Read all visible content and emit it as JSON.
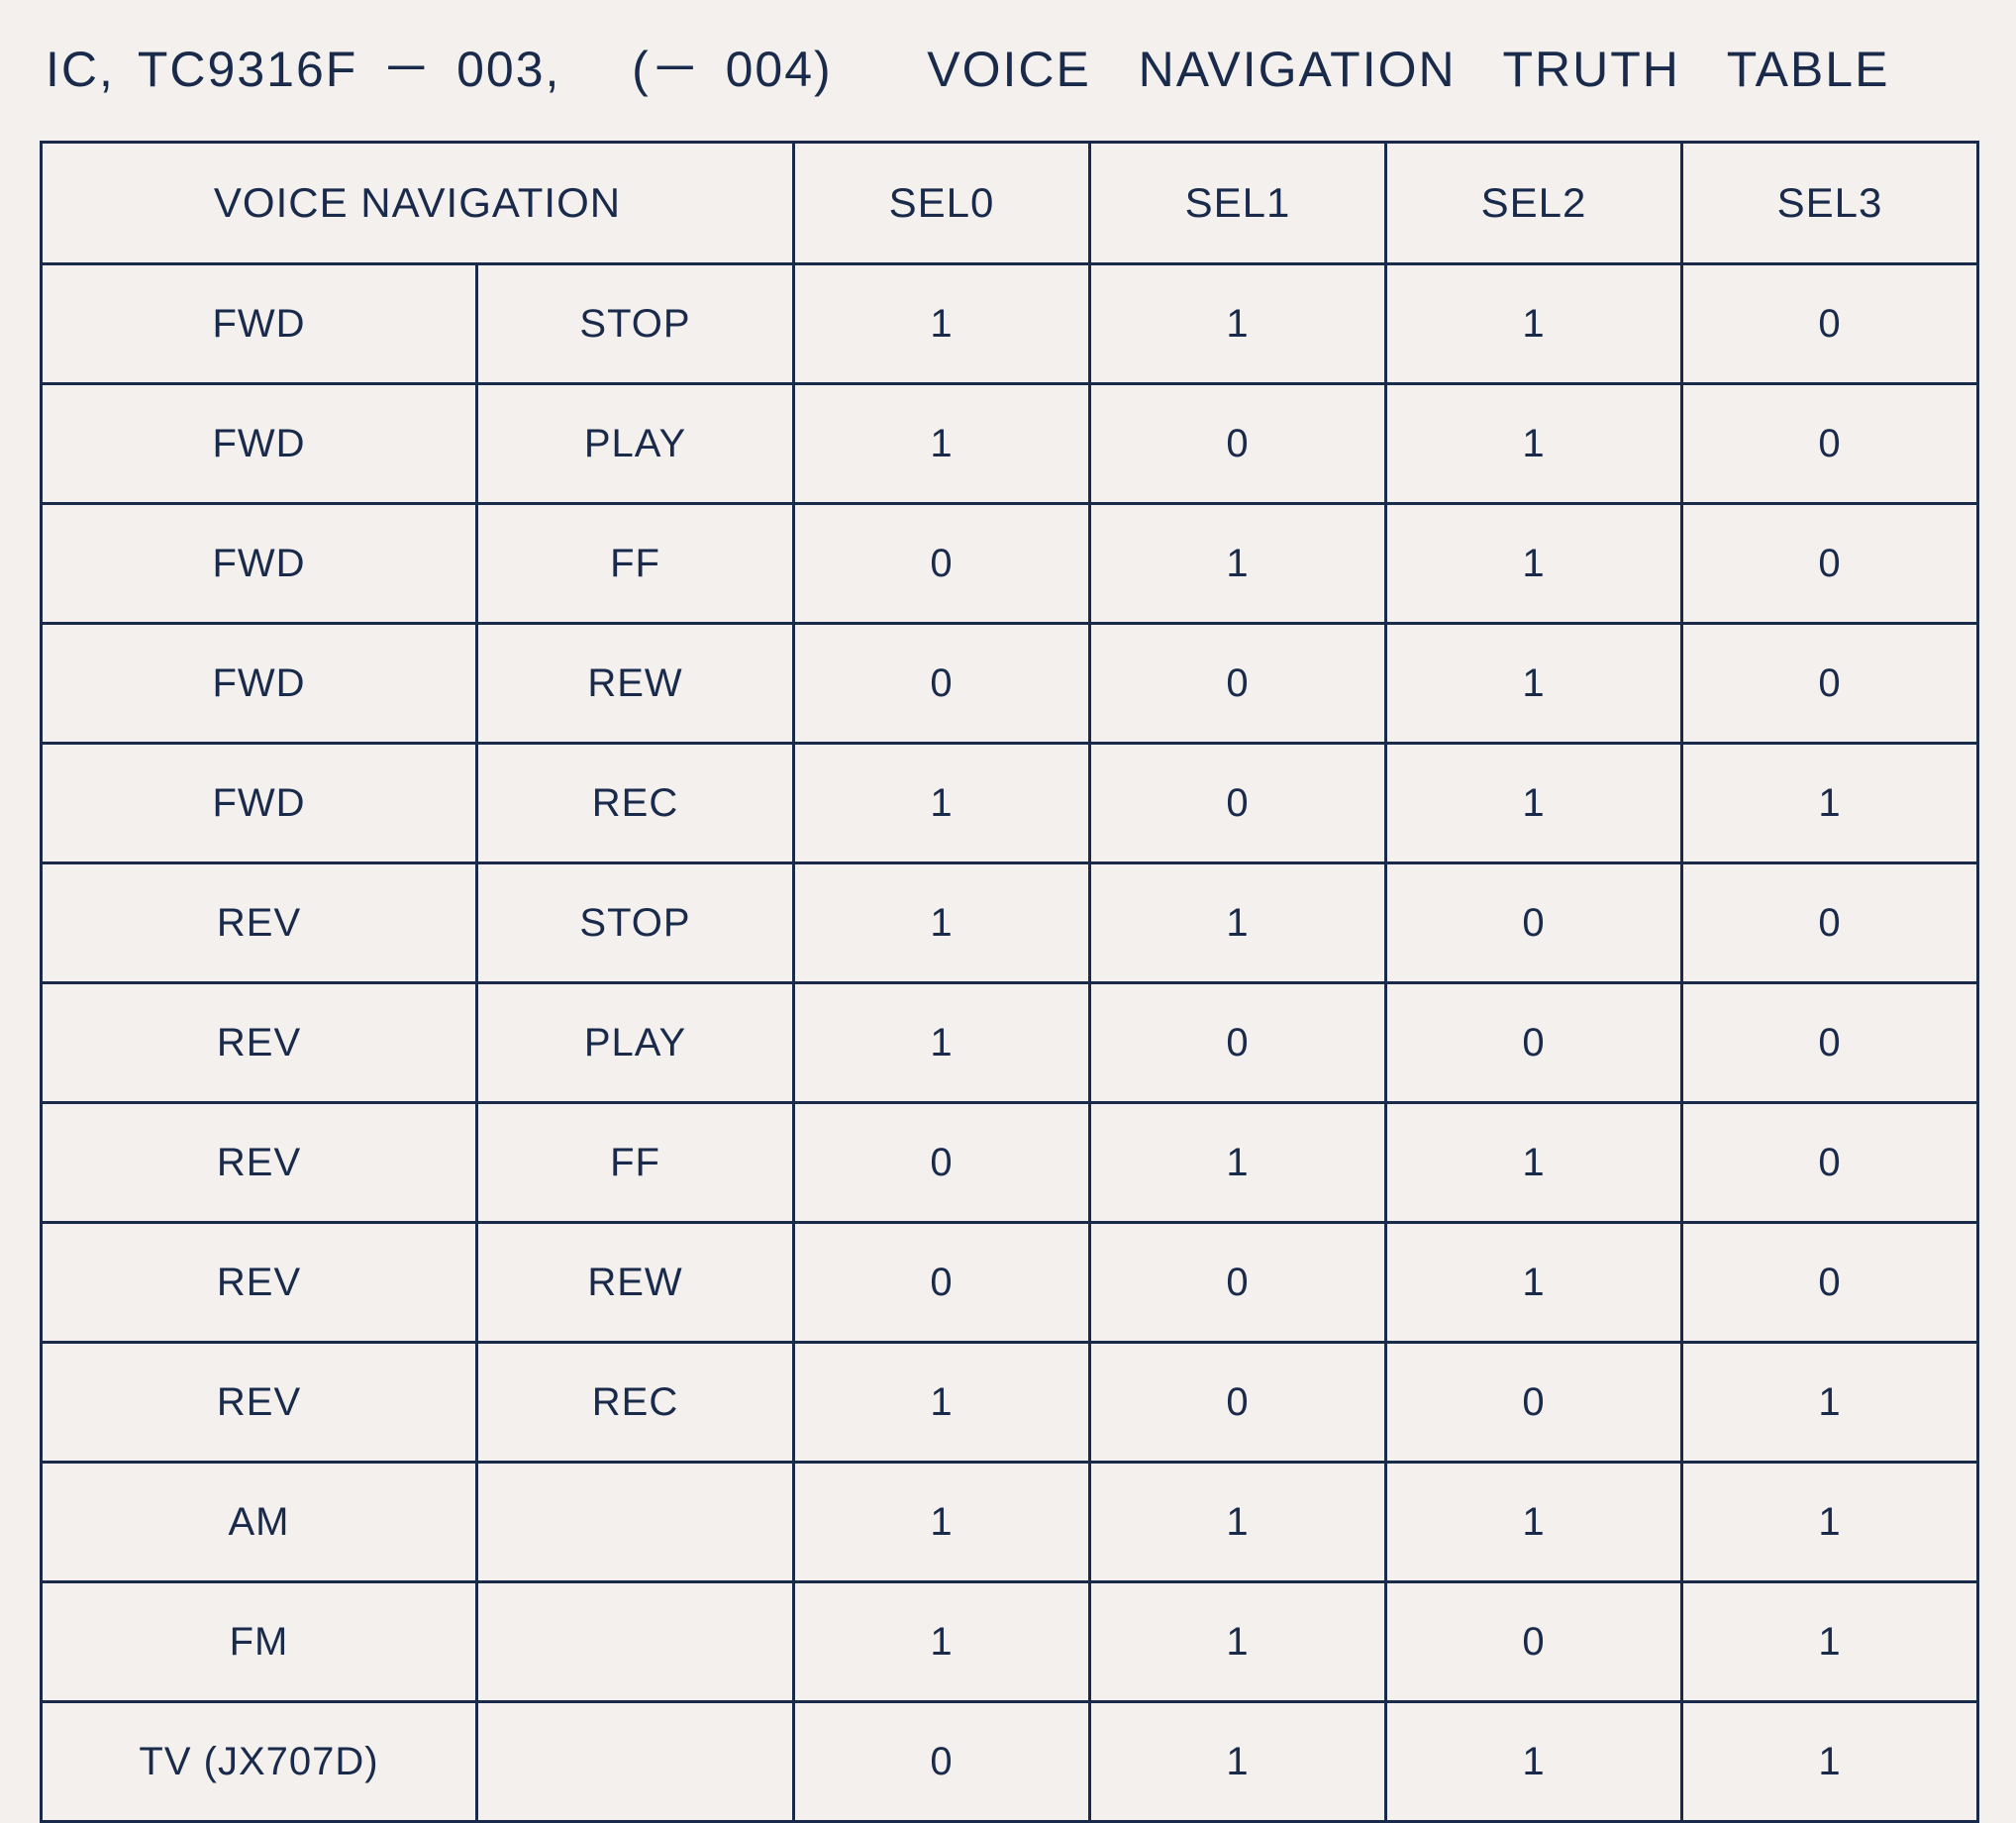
{
  "title": "IC, TC9316F － 003,   (－ 004)    VOICE  NAVIGATION  TRUTH  TABLE",
  "headers": {
    "voice_nav": "VOICE  NAVIGATION",
    "sel0": "SEL0",
    "sel1": "SEL1",
    "sel2": "SEL2",
    "sel3": "SEL3"
  },
  "rows": [
    {
      "vn_a": "FWD",
      "vn_b": "STOP",
      "sel0": "1",
      "sel1": "1",
      "sel2": "1",
      "sel3": "0"
    },
    {
      "vn_a": "FWD",
      "vn_b": "PLAY",
      "sel0": "1",
      "sel1": "0",
      "sel2": "1",
      "sel3": "0"
    },
    {
      "vn_a": "FWD",
      "vn_b": "FF",
      "sel0": "0",
      "sel1": "1",
      "sel2": "1",
      "sel3": "0"
    },
    {
      "vn_a": "FWD",
      "vn_b": "REW",
      "sel0": "0",
      "sel1": "0",
      "sel2": "1",
      "sel3": "0"
    },
    {
      "vn_a": "FWD",
      "vn_b": "REC",
      "sel0": "1",
      "sel1": "0",
      "sel2": "1",
      "sel3": "1"
    },
    {
      "vn_a": "REV",
      "vn_b": "STOP",
      "sel0": "1",
      "sel1": "1",
      "sel2": "0",
      "sel3": "0"
    },
    {
      "vn_a": "REV",
      "vn_b": "PLAY",
      "sel0": "1",
      "sel1": "0",
      "sel2": "0",
      "sel3": "0"
    },
    {
      "vn_a": "REV",
      "vn_b": "FF",
      "sel0": "0",
      "sel1": "1",
      "sel2": "1",
      "sel3": "0"
    },
    {
      "vn_a": "REV",
      "vn_b": "REW",
      "sel0": "0",
      "sel1": "0",
      "sel2": "1",
      "sel3": "0"
    },
    {
      "vn_a": "REV",
      "vn_b": "REC",
      "sel0": "1",
      "sel1": "0",
      "sel2": "0",
      "sel3": "1"
    },
    {
      "vn_a": "AM",
      "vn_b": "",
      "sel0": "1",
      "sel1": "1",
      "sel2": "1",
      "sel3": "1"
    },
    {
      "vn_a": "FM",
      "vn_b": "",
      "sel0": "1",
      "sel1": "1",
      "sel2": "0",
      "sel3": "1"
    },
    {
      "vn_a": "TV (JX707D)",
      "vn_b": "",
      "sel0": "0",
      "sel1": "1",
      "sel2": "1",
      "sel3": "1"
    }
  ]
}
